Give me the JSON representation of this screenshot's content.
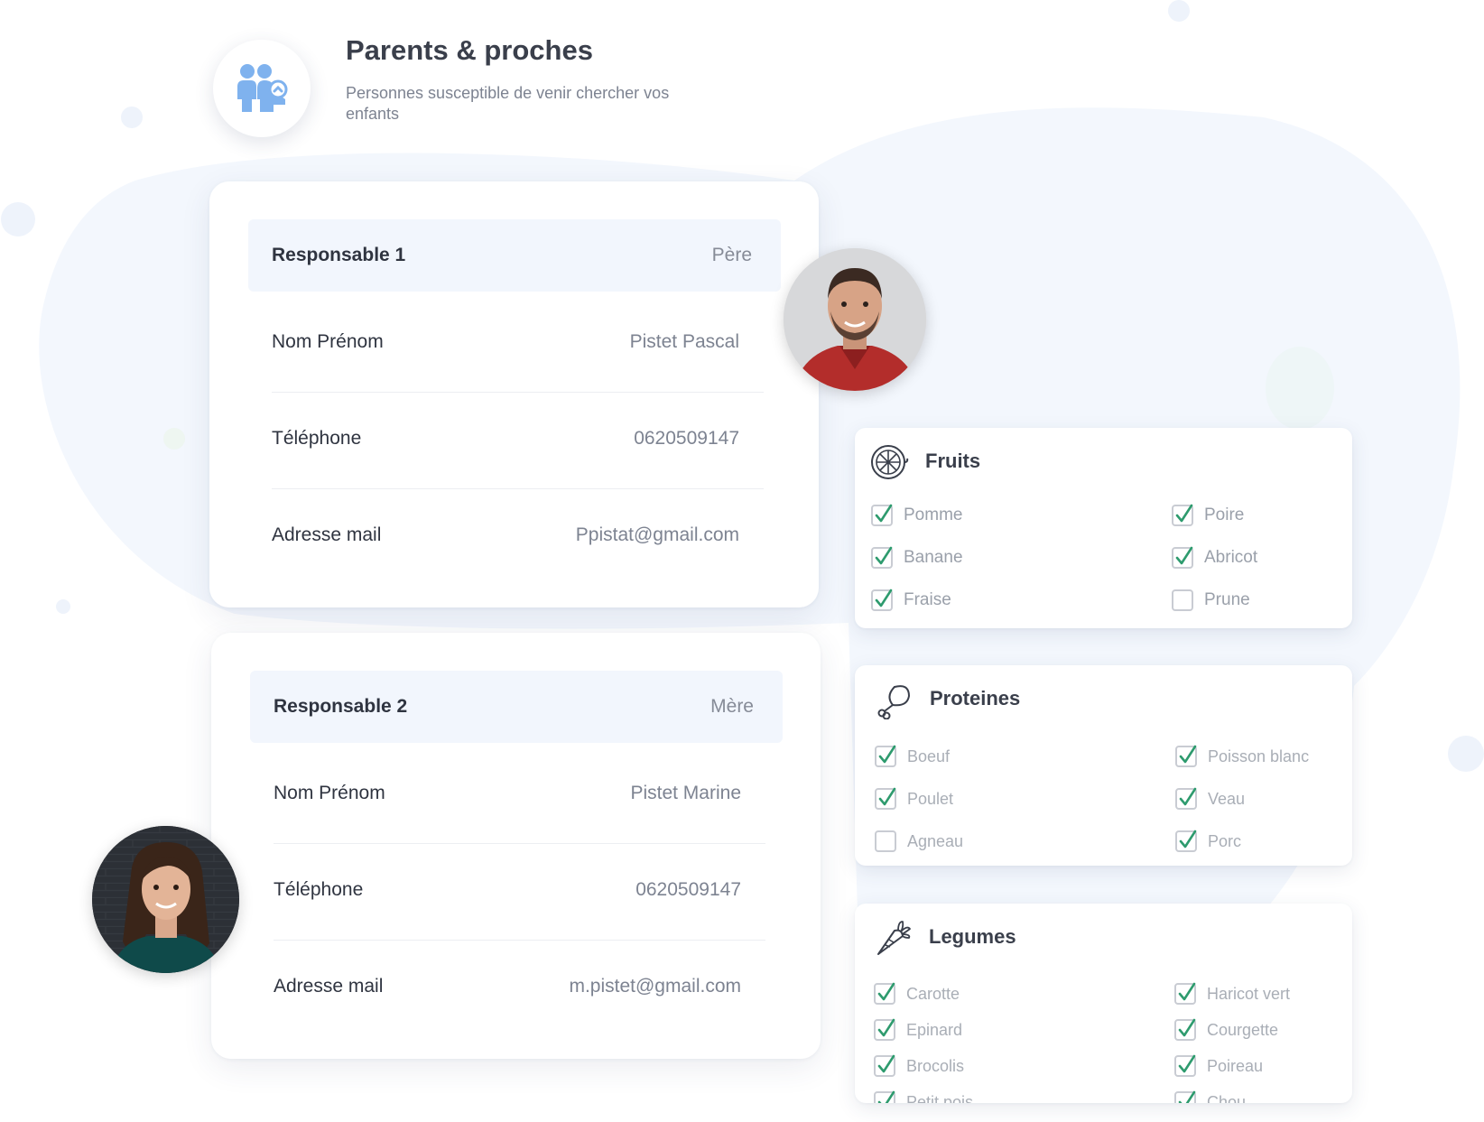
{
  "header": {
    "title": "Parents & proches",
    "subtitle": "Personnes susceptible de venir chercher vos enfants",
    "icon": "family-icon",
    "accent_color": "#7fb2ee"
  },
  "responsables": [
    {
      "title": "Responsable 1",
      "role": "Père",
      "rows": [
        {
          "label": "Nom Prénom",
          "value": "Pistet Pascal"
        },
        {
          "label": "Téléphone",
          "value": "0620509147"
        },
        {
          "label": "Adresse mail",
          "value": "Ppistat@gmail.com"
        }
      ]
    },
    {
      "title": "Responsable 2",
      "role": "Mère",
      "rows": [
        {
          "label": "Nom Prénom",
          "value": "Pistet Marine"
        },
        {
          "label": "Téléphone",
          "value": "0620509147"
        },
        {
          "label": "Adresse mail",
          "value": "m.pistet@gmail.com"
        }
      ]
    }
  ],
  "food": [
    {
      "title": "Fruits",
      "icon": "lemon-slice-icon",
      "items": [
        {
          "label": "Pomme",
          "checked": true
        },
        {
          "label": "Poire",
          "checked": true
        },
        {
          "label": "Banane",
          "checked": true
        },
        {
          "label": "Abricot",
          "checked": true
        },
        {
          "label": "Fraise",
          "checked": true
        },
        {
          "label": "Prune",
          "checked": false
        }
      ]
    },
    {
      "title": "Proteines",
      "icon": "drumstick-icon",
      "items": [
        {
          "label": "Boeuf",
          "checked": true
        },
        {
          "label": "Poisson blanc",
          "checked": true
        },
        {
          "label": "Poulet",
          "checked": true
        },
        {
          "label": "Veau",
          "checked": true
        },
        {
          "label": "Agneau",
          "checked": false
        },
        {
          "label": "Porc",
          "checked": true
        }
      ]
    },
    {
      "title": "Legumes",
      "icon": "carrot-icon",
      "items": [
        {
          "label": "Carotte",
          "checked": true
        },
        {
          "label": "Haricot vert",
          "checked": true
        },
        {
          "label": "Epinard",
          "checked": true
        },
        {
          "label": "Courgette",
          "checked": true
        },
        {
          "label": "Brocolis",
          "checked": true
        },
        {
          "label": "Poireau",
          "checked": true
        },
        {
          "label": "Petit pois",
          "checked": true
        },
        {
          "label": "Chou",
          "checked": true
        }
      ]
    }
  ],
  "colors": {
    "check": "#2e9b6e",
    "head_background": "#f2f6fd",
    "blob": "#f3f7fd"
  }
}
